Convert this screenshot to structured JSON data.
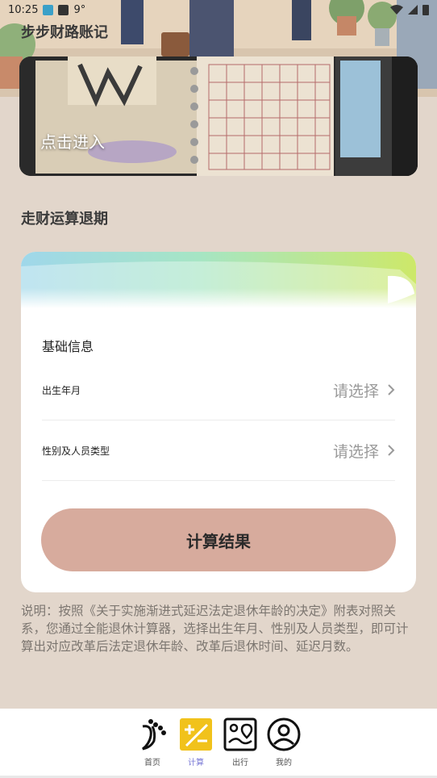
{
  "status_bar": {
    "time": "10:25",
    "weather": "9°"
  },
  "app": {
    "title": "步步财路账记"
  },
  "banner": {
    "enter_label": "点击进入"
  },
  "section": {
    "title": "走财运算退期"
  },
  "calculator": {
    "basic_info_label": "基础信息",
    "rows": [
      {
        "label": "出生年月",
        "value": "请选择"
      },
      {
        "label": "性别及人员类型",
        "value": "请选择"
      }
    ],
    "submit_label": "计算结果"
  },
  "description": "说明：按照《关于实施渐进式延迟法定退休年龄的决定》附表对照关系，您通过全能退休计算器，选择出生年月、性别及人员类型，即可计算出对应改革后法定退休年龄、改革后退休时间、延迟月数。",
  "bottom_nav": {
    "items": [
      {
        "label": "首页",
        "icon": "footprint-icon",
        "active": false
      },
      {
        "label": "计算",
        "icon": "calculator-icon",
        "active": true
      },
      {
        "label": "出行",
        "icon": "map-icon",
        "active": false
      },
      {
        "label": "我的",
        "icon": "user-icon",
        "active": false
      }
    ]
  },
  "colors": {
    "page_bg": "#e2d6cb",
    "button": "#d7ab9d",
    "active_nav": "#7a79d6",
    "active_icon_bg": "#f1c21b"
  }
}
